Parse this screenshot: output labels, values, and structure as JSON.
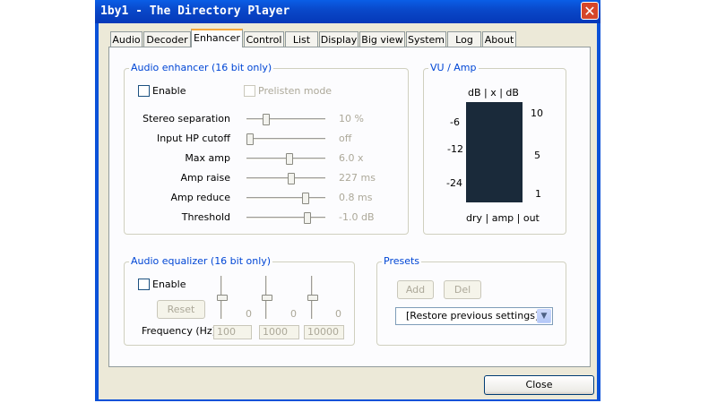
{
  "window": {
    "title": "1by1 - The Directory Player",
    "close_icon": "close-icon"
  },
  "tabs": [
    {
      "label": "Audio",
      "active": false
    },
    {
      "label": "Decoder",
      "active": false
    },
    {
      "label": "Enhancer",
      "active": true
    },
    {
      "label": "Control",
      "active": false
    },
    {
      "label": "List",
      "active": false
    },
    {
      "label": "Display",
      "active": false
    },
    {
      "label": "Big view",
      "active": false
    },
    {
      "label": "System",
      "active": false
    },
    {
      "label": "Log",
      "active": false
    },
    {
      "label": "About",
      "active": false
    }
  ],
  "enhancer": {
    "title": "Audio enhancer (16 bit only)",
    "enable_label": "Enable",
    "enable_checked": false,
    "prelisten_label": "Prelisten mode",
    "prelisten_checked": false,
    "sliders": [
      {
        "label": "Stereo separation",
        "value": "10 %",
        "position": 0.22
      },
      {
        "label": "Input HP cutoff",
        "value": "off",
        "position": 0.0
      },
      {
        "label": "Max amp",
        "value": "6.0 x",
        "position": 0.55
      },
      {
        "label": "Amp raise",
        "value": "227 ms",
        "position": 0.58
      },
      {
        "label": "Amp reduce",
        "value": "0.8 ms",
        "position": 0.78
      },
      {
        "label": "Threshold",
        "value": "-1.0 dB",
        "position": 0.8
      }
    ]
  },
  "vu": {
    "title": "VU / Amp",
    "header": "dB | x | dB",
    "left_scale": [
      "-6",
      "-12",
      "-24"
    ],
    "right_scale": [
      "10",
      "5",
      "1"
    ],
    "footer": "dry | amp | out"
  },
  "equalizer": {
    "title": "Audio equalizer (16 bit only)",
    "enable_label": "Enable",
    "enable_checked": false,
    "reset_label": "Reset",
    "frequency_label": "Frequency (Hz):",
    "bands": [
      {
        "frequency": "100",
        "gain": "0"
      },
      {
        "frequency": "1000",
        "gain": "0"
      },
      {
        "frequency": "10000",
        "gain": "0"
      }
    ]
  },
  "presets": {
    "title": "Presets",
    "add_label": "Add",
    "del_label": "Del",
    "selected": "[Restore previous settings]"
  },
  "footer": {
    "close_label": "Close"
  }
}
